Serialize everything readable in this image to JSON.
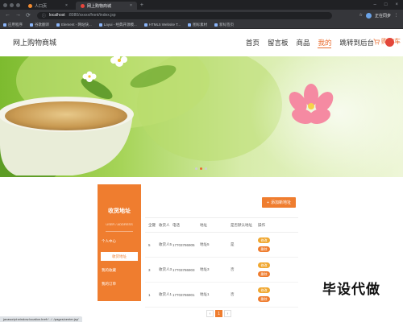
{
  "browser": {
    "tabs": [
      {
        "title": "人口页",
        "active": false
      },
      {
        "title": "网上购物商城",
        "active": true
      }
    ],
    "url_host": "localhost",
    "url_path": ":8080/xxxxx/front/index.jsp",
    "profile_label": "正在同步",
    "bookmarks": [
      "应用程序",
      "谷歌翻译",
      "Element - 网站快...",
      "Layui - 经典开源模...",
      "HTML5 Website T...",
      "图标素材",
      "新标签页"
    ]
  },
  "site": {
    "title": "网上购物商城",
    "menu": [
      "首页",
      "留言板",
      "商品",
      "我的",
      "跳转到后台"
    ],
    "active_menu": "我的",
    "cart_label": "购物车"
  },
  "sidebar": {
    "title": "收货地址",
    "subtitle": "USER / ADDRESS",
    "items": [
      "个人中心",
      "收货地址",
      "我的收藏",
      "我的订单"
    ],
    "active_item": "收货地址"
  },
  "add_button": "添加新地址",
  "table": {
    "headers": [
      "全键",
      "收货人",
      "电话",
      "地址",
      "是否默认地址",
      "操作"
    ],
    "rows": [
      {
        "id": "5",
        "name": "收货人5",
        "phone": "17703786905",
        "address": "地址5",
        "default": "是",
        "edit": "修改",
        "delete": "删除"
      },
      {
        "id": "3",
        "name": "收货人3",
        "phone": "17703786903",
        "address": "地址3",
        "default": "否",
        "edit": "修改",
        "delete": "删除"
      },
      {
        "id": "1",
        "name": "收货人1",
        "phone": "17703786901",
        "address": "地址1",
        "default": "否",
        "edit": "修改",
        "delete": "删除"
      }
    ]
  },
  "pagination": {
    "prev": "‹",
    "current": "1",
    "next": "›"
  },
  "watermark": "毕设代做",
  "status_url": "javascript:window.location.href='../../pages/center.jsp'",
  "colors": {
    "accent": "#ef7d2f",
    "menu_active": "#e96a2c"
  }
}
